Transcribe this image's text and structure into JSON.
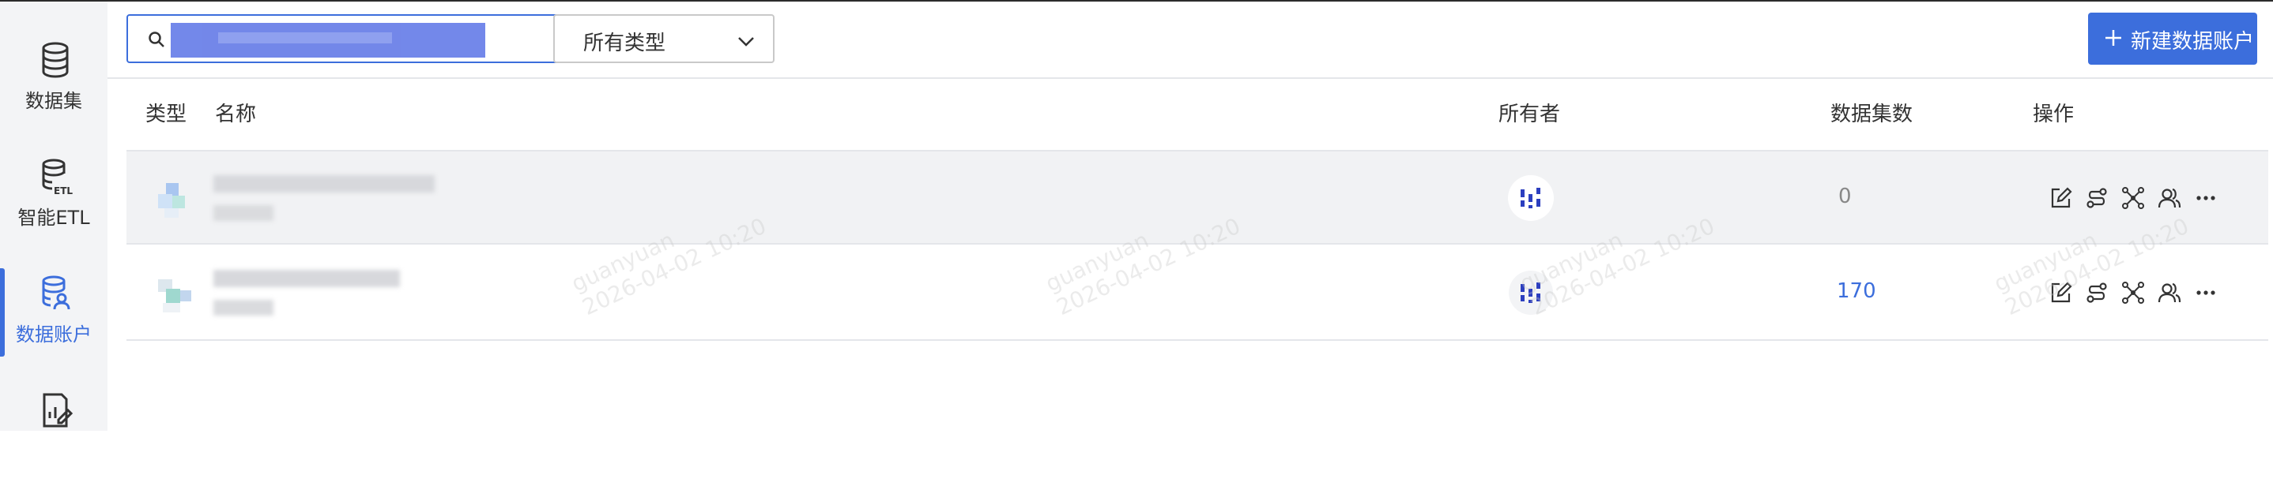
{
  "sidebar": {
    "items": [
      {
        "label": "数据集",
        "icon": "database-icon",
        "active": false
      },
      {
        "label": "智能ETL",
        "icon": "etl-database-icon",
        "active": false
      },
      {
        "label": "数据账户",
        "icon": "data-account-icon",
        "active": true
      },
      {
        "label": "",
        "icon": "report-edit-icon",
        "active": false
      }
    ]
  },
  "toolbar": {
    "search": {
      "value": "",
      "placeholder": ""
    },
    "type_filter": {
      "selected": "所有类型",
      "icon": "chevron-down-icon"
    },
    "new_button_label": "新建数据账户"
  },
  "table": {
    "headers": {
      "type": "类型",
      "name": "名称",
      "owner": "所有者",
      "dataset_count": "数据集数",
      "actions": "操作"
    },
    "rows": [
      {
        "dataset_count": "0"
      },
      {
        "dataset_count": "170"
      }
    ],
    "action_icons": [
      "edit-icon",
      "connection-icon",
      "lineage-icon",
      "users-icon",
      "more-icon"
    ]
  },
  "watermark": {
    "user": "guanyuan",
    "time": "2026-04-02 10:20"
  },
  "colors": {
    "accent": "#3c6edc",
    "sidebar_bg": "#f3f4f6",
    "row_hover": "#f1f2f4"
  }
}
